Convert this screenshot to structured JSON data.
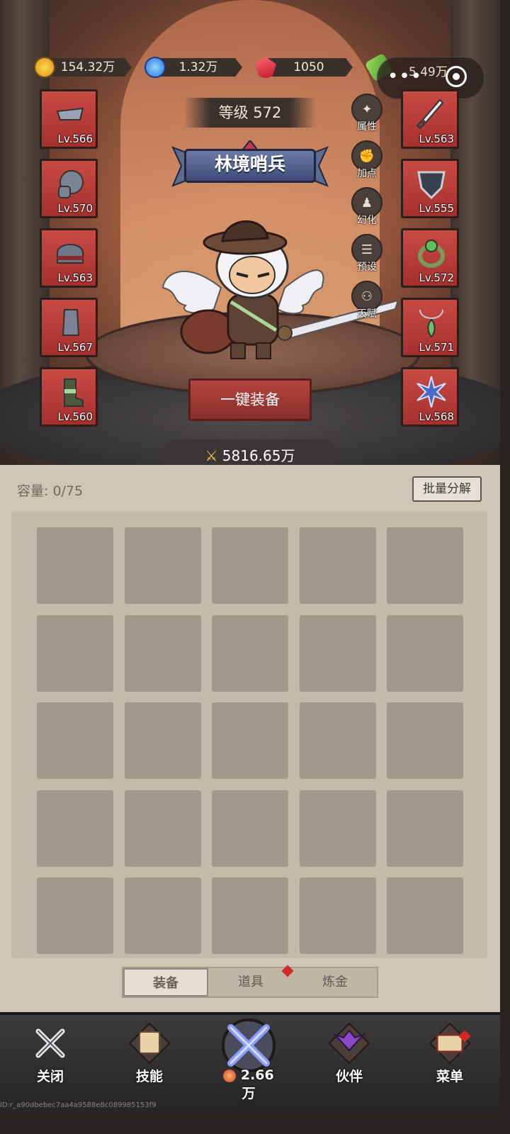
{
  "resources": {
    "gold": "154.32万",
    "crystal": "1.32万",
    "ruby": "1050",
    "energy": "5.49万"
  },
  "hero": {
    "level_label": "等级 572",
    "title": "林境哨兵",
    "power": "5816.65万"
  },
  "side_menu": [
    "属性",
    "加点",
    "幻化",
    "预设",
    "天赋"
  ],
  "equip_left": [
    {
      "level": "Lv.566",
      "item": "bracer"
    },
    {
      "level": "Lv.570",
      "item": "pauldron"
    },
    {
      "level": "Lv.563",
      "item": "helmet"
    },
    {
      "level": "Lv.567",
      "item": "greave"
    },
    {
      "level": "Lv.560",
      "item": "boots"
    }
  ],
  "equip_right": [
    {
      "level": "Lv.563",
      "item": "sword"
    },
    {
      "level": "Lv.555",
      "item": "shield"
    },
    {
      "level": "Lv.572",
      "item": "ring"
    },
    {
      "level": "Lv.571",
      "item": "necklace"
    },
    {
      "level": "Lv.568",
      "item": "star-emblem"
    }
  ],
  "equip_button": "一键装备",
  "inventory": {
    "capacity": "容量: 0/75",
    "decompose_button": "批量分解",
    "rows": 5,
    "cols": 5
  },
  "tabs": [
    "装备",
    "道具",
    "炼金"
  ],
  "bottom_nav": {
    "close": "关闭",
    "skills": "技能",
    "battle_amount": "2.66万",
    "partner": "伙伴",
    "menu": "菜单"
  },
  "footer_id": "ID:r_a90dbebec7aa4a9588e8c089985153f9",
  "colors": {
    "slot_red": "#b83a36",
    "panel": "#cdc6b4",
    "cell": "#a09a8c",
    "badge_red": "#d22828"
  }
}
